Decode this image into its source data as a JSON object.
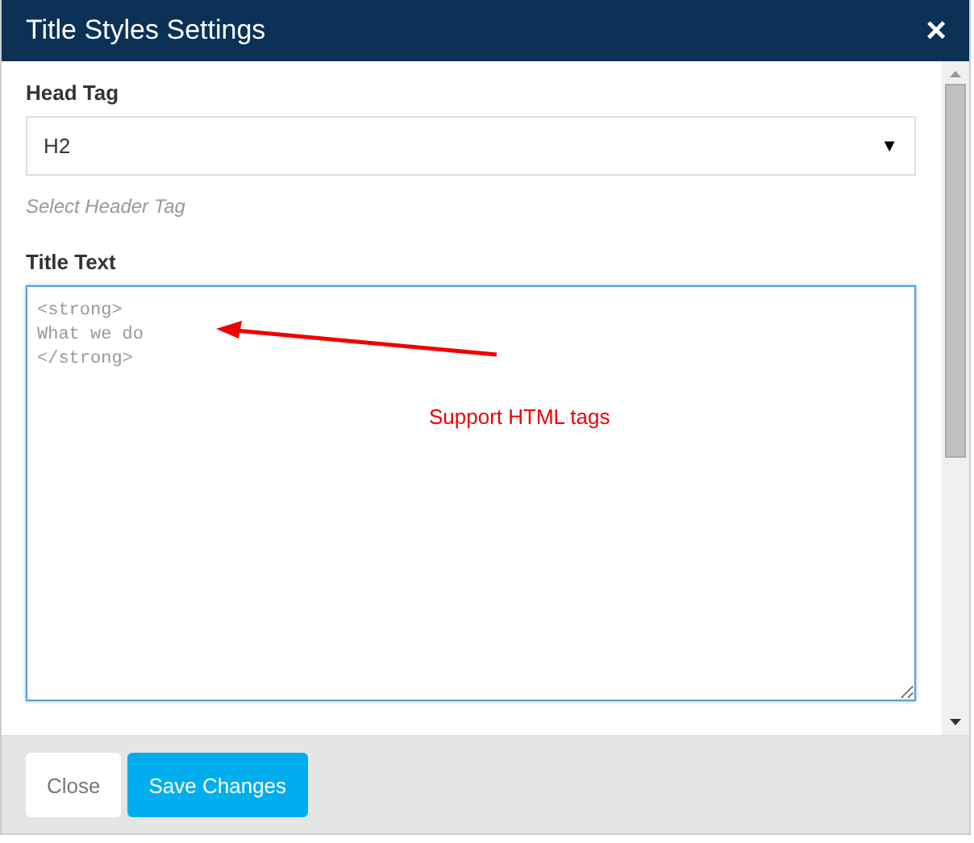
{
  "dialog": {
    "title": "Title Styles Settings",
    "close_glyph": "×"
  },
  "head_tag": {
    "label": "Head Tag",
    "value": "H2",
    "caret": "▼",
    "help": "Select Header Tag"
  },
  "title_text": {
    "label": "Title Text",
    "value": "<strong>\nWhat we do\n</strong>"
  },
  "annotation": {
    "text": "Support HTML tags"
  },
  "buttons": [
    {
      "label": "Close",
      "kind": "secondary"
    },
    {
      "label": "Save Changes",
      "kind": "primary"
    }
  ]
}
